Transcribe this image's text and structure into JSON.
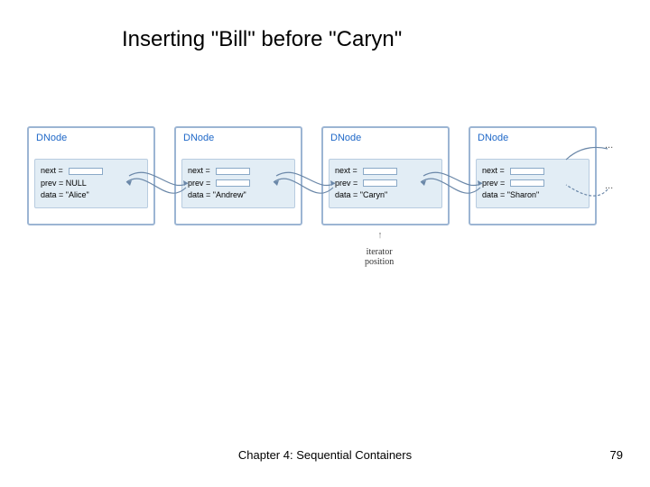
{
  "slide": {
    "title": "Inserting \"Bill\" before \"Caryn\"",
    "footer_text": "Chapter 4: Sequential Containers",
    "page_number": "79"
  },
  "diagram": {
    "node_type_label": "DNode",
    "nodes": [
      {
        "next": "next =",
        "prev": "prev = NULL",
        "data": "data = \"Alice\""
      },
      {
        "next": "next =",
        "prev": "prev =",
        "data": "data = \"Andrew\""
      },
      {
        "next": "next =",
        "prev": "prev =",
        "data": "data = \"Caryn\""
      },
      {
        "next": "next =",
        "prev": "prev =",
        "data": "data = \"Sharon\""
      }
    ],
    "iterator_label_1": "iterator",
    "iterator_label_2": "position",
    "ellipsis": "..."
  }
}
